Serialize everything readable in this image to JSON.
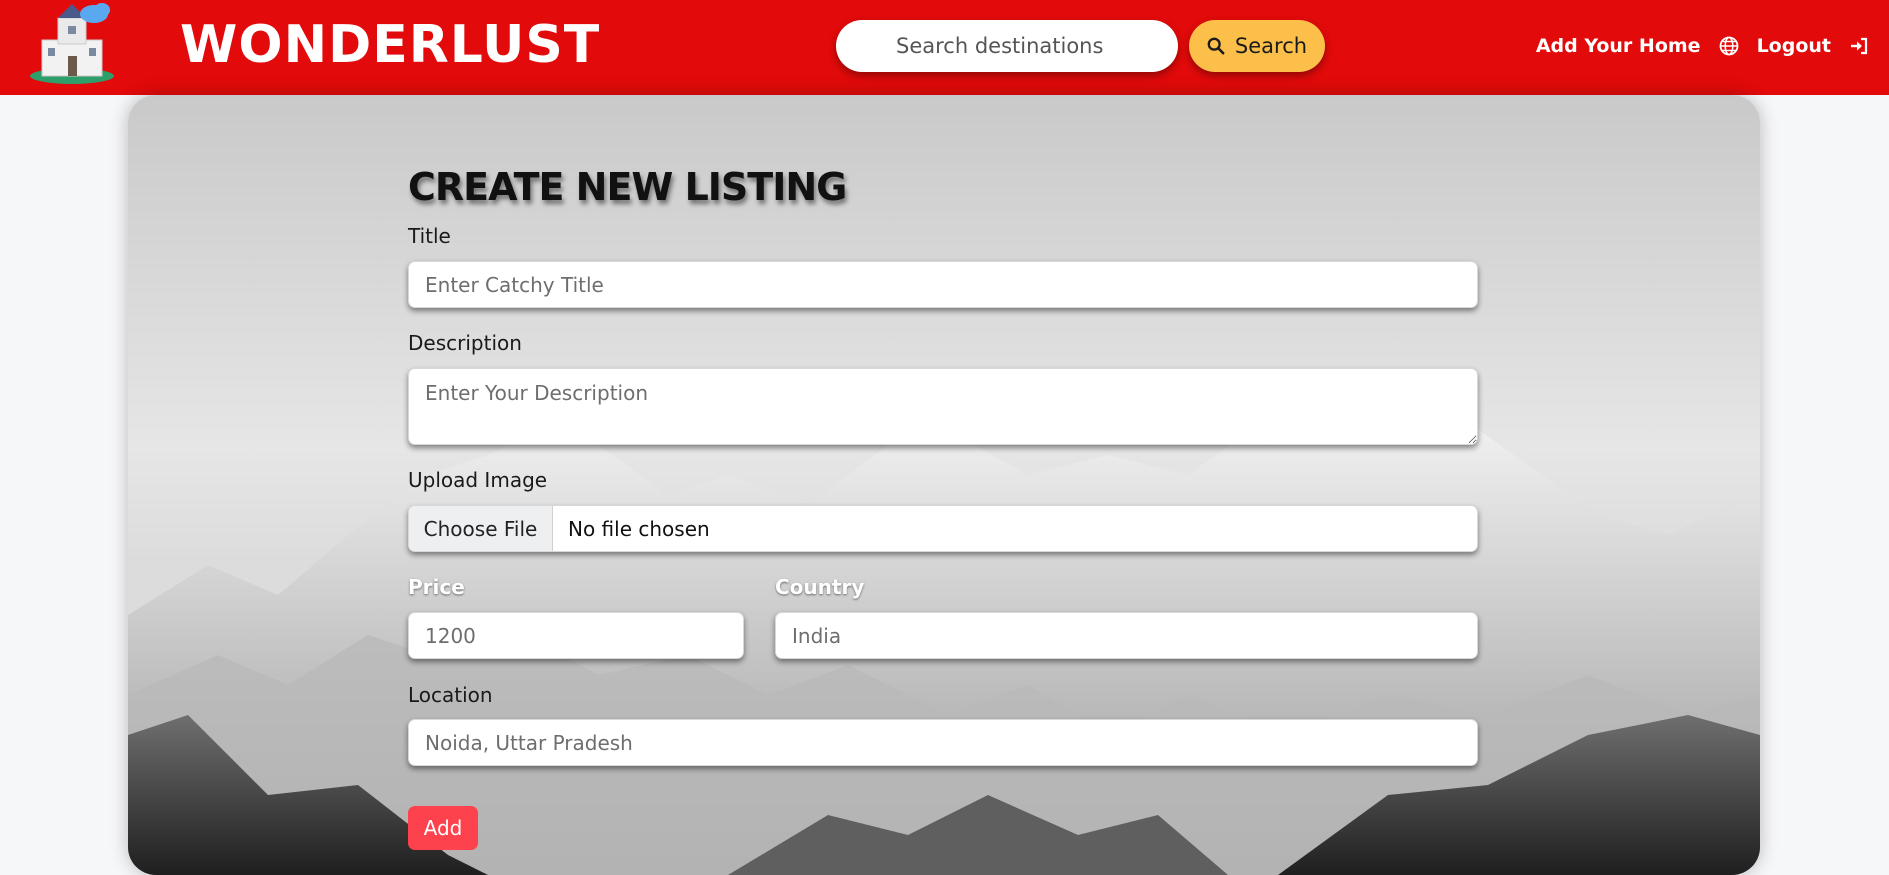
{
  "navbar": {
    "brand": "WONDERLUST",
    "search_placeholder": "Search destinations",
    "search_button": "Search",
    "add_home": "Add Your Home",
    "logout": "Logout",
    "colors": {
      "bar": "#e20a0a",
      "search_button": "#fbbf4a"
    },
    "icons": [
      "castle-logo-icon",
      "search-icon",
      "globe-icon",
      "logout-icon"
    ]
  },
  "form": {
    "heading": "CREATE NEW LISTING",
    "title_label": "Title",
    "title_placeholder": "Enter Catchy Title",
    "description_label": "Description",
    "description_placeholder": "Enter Your Description",
    "image_label": "Upload Image",
    "file_button": "Choose File",
    "file_status": "No file chosen",
    "price_label": "Price",
    "price_placeholder": "1200",
    "country_label": "Country",
    "country_placeholder": "India",
    "location_label": "Location",
    "location_placeholder": "Noida, Uttar Pradesh",
    "submit": "Add",
    "submit_color": "#fe424d"
  }
}
